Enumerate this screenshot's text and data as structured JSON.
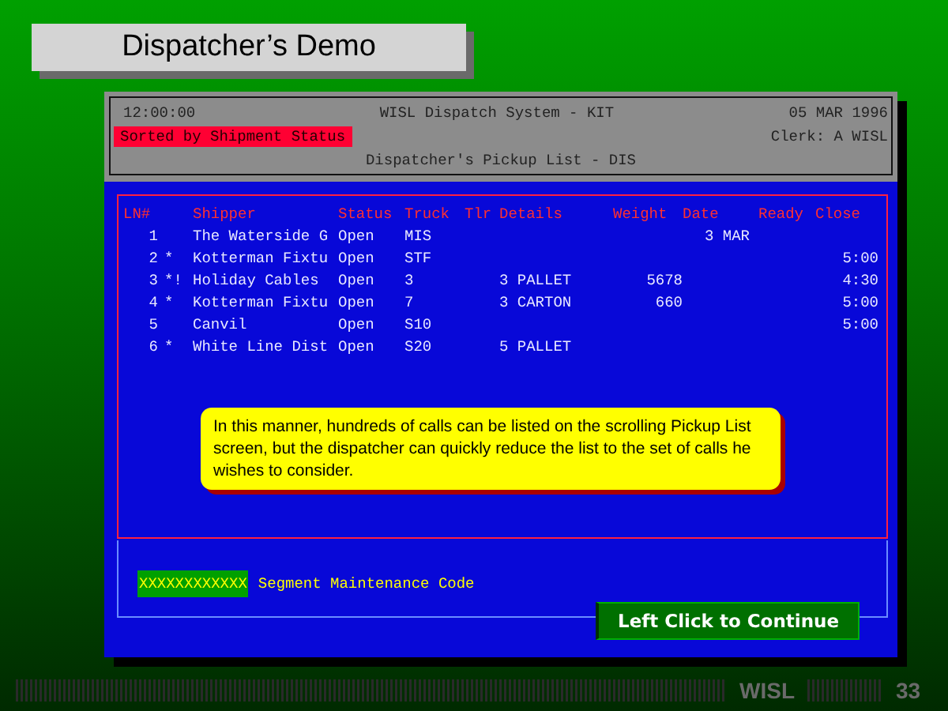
{
  "slide_title": "Dispatcher’s Demo",
  "terminal": {
    "time": "12:00:00",
    "system": "WISL Dispatch System - KIT",
    "date": "05 MAR 1996",
    "sort_label": "Sorted by Shipment Status",
    "clerk": "Clerk: A WISL",
    "screen_title": "Dispatcher's Pickup List - DIS"
  },
  "table": {
    "columns": [
      "LN#",
      "Shipper",
      "Status",
      "Truck",
      "Tlr",
      "Details",
      "Weight",
      "Date",
      "Ready",
      "Close"
    ],
    "rows": [
      {
        "ln": "1",
        "flag": "",
        "shipper": "The Waterside G",
        "status": "Open",
        "truck": "MIS",
        "details": "",
        "weight": "",
        "date": "3 MAR",
        "close": ""
      },
      {
        "ln": "2",
        "flag": "*",
        "shipper": "Kotterman Fixtu",
        "status": "Open",
        "truck": "STF",
        "details": "",
        "weight": "",
        "date": "",
        "close": "5:00"
      },
      {
        "ln": "3",
        "flag": "*!",
        "shipper": "Holiday Cables",
        "status": "Open",
        "truck": "3",
        "details": "3 PALLET",
        "weight": "5678",
        "date": "",
        "close": "4:30"
      },
      {
        "ln": "4",
        "flag": "*",
        "shipper": "Kotterman Fixtu",
        "status": "Open",
        "truck": "7",
        "details": "3 CARTON",
        "weight": "660",
        "date": "",
        "close": "5:00"
      },
      {
        "ln": "5",
        "flag": "",
        "shipper": "Canvil",
        "status": "Open",
        "truck": "S10",
        "details": "",
        "weight": "",
        "date": "",
        "close": "5:00"
      },
      {
        "ln": "6",
        "flag": "*",
        "shipper": "White Line Dist",
        "status": "Open",
        "truck": "S20",
        "details": "5 PALLET",
        "weight": "",
        "date": "",
        "close": ""
      }
    ]
  },
  "callout": "In this manner, hundreds of calls can be listed on the scrolling Pickup List screen, but the dispatcher  can quickly reduce the list to the set of calls he wishes to consider.",
  "segment": {
    "value": "XXXXXXXXXXXX",
    "label": "Segment Maintenance Code"
  },
  "continue_button": "Left Click to Continue",
  "footer": {
    "brand": "WISL",
    "page": "33"
  }
}
